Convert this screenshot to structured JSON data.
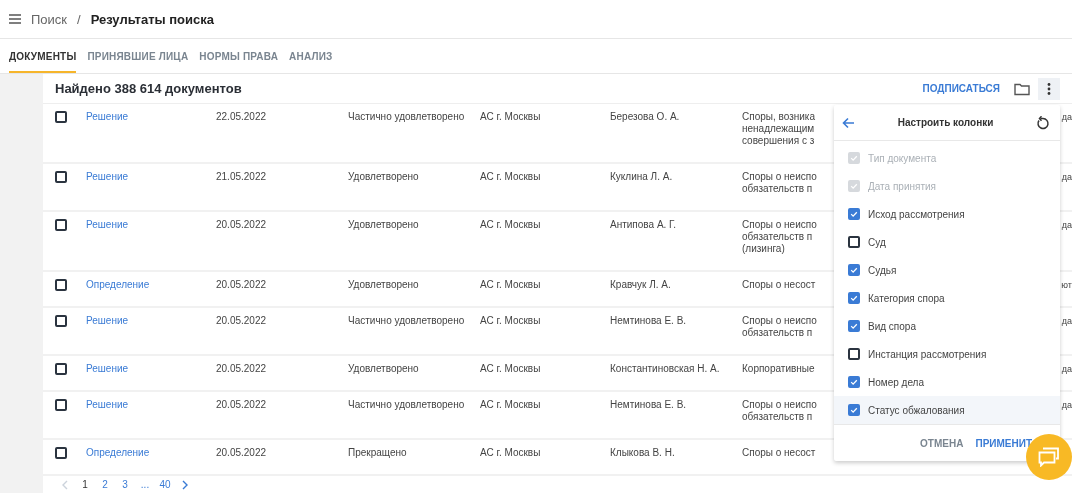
{
  "header": {
    "breadcrumb": [
      {
        "label": "Поиск",
        "current": false
      },
      {
        "label": "Результаты поиска",
        "current": true
      }
    ],
    "separator": "/"
  },
  "tabs": [
    {
      "label": "ДОКУМЕНТЫ",
      "selected": true
    },
    {
      "label": "ПРИНЯВШИЕ ЛИЦА",
      "selected": false
    },
    {
      "label": "НОРМЫ ПРАВА",
      "selected": false
    },
    {
      "label": "АНАЛИЗ",
      "selected": false
    }
  ],
  "results": {
    "title": "Найдено 388 614 документов",
    "subscribe": "ПОДПИСАТЬСЯ",
    "rows": [
      {
        "checked": false,
        "type": "Решение",
        "date": "22.05.2022",
        "outcome": "Частично удовлетворено",
        "court": "АС г. Москвы",
        "judge": "Березова О. А.",
        "category": [
          "Споры, возника",
          "ненадлежащим",
          "совершения с з"
        ],
        "column_7": "да"
      },
      {
        "checked": false,
        "type": "Решение",
        "date": "21.05.2022",
        "outcome": "Удовлетворено",
        "court": "АС г. Москвы",
        "judge": "Куклина Л. А.",
        "category": [
          "Споры о неиспо",
          "обязательств п"
        ],
        "column_7": "да"
      },
      {
        "checked": false,
        "type": "Решение",
        "date": "20.05.2022",
        "outcome": "Удовлетворено",
        "court": "АС г. Москвы",
        "judge": "Антипова А. Г.",
        "category": [
          "Споры о неиспо",
          "обязательств п",
          "(лизинга)"
        ],
        "column_7": "да"
      },
      {
        "checked": false,
        "type": "Определение",
        "date": "20.05.2022",
        "outcome": "Удовлетворено",
        "court": "АС г. Москвы",
        "judge": "Кравчук Л. А.",
        "category": [
          "Споры о несост"
        ],
        "column_7": "ют"
      },
      {
        "checked": false,
        "type": "Решение",
        "date": "20.05.2022",
        "outcome": "Частично удовлетворено",
        "court": "АС г. Москвы",
        "judge": "Немтинова Е. В.",
        "category": [
          "Споры о неиспо",
          "обязательств п"
        ],
        "column_7": "да"
      },
      {
        "checked": false,
        "type": "Решение",
        "date": "20.05.2022",
        "outcome": "Удовлетворено",
        "court": "АС г. Москвы",
        "judge": "Константиновская Н. А.",
        "category": [
          "Корпоративные"
        ],
        "column_7": "да"
      },
      {
        "checked": false,
        "type": "Решение",
        "date": "20.05.2022",
        "outcome": "Частично удовлетворено",
        "court": "АС г. Москвы",
        "judge": "Немтинова Е. В.",
        "category": [
          "Споры о неиспо",
          "обязательств п"
        ],
        "column_7": "да"
      },
      {
        "checked": false,
        "type": "Определение",
        "date": "20.05.2022",
        "outcome": "Прекращено",
        "court": "АС г. Москвы",
        "judge": "Клыкова В. Н.",
        "category": [
          "Споры о несост"
        ]
      }
    ]
  },
  "pagination": {
    "prev_disabled": true,
    "pages": [
      {
        "label": "1",
        "selected": true
      },
      {
        "label": "2",
        "selected": false
      },
      {
        "label": "3",
        "selected": false
      },
      {
        "label": "...",
        "selected": false
      },
      {
        "label": "40",
        "selected": false
      }
    ]
  },
  "columns_popup": {
    "title": "Настроить колонки",
    "items": [
      {
        "label": "Тип документа",
        "checked": true,
        "disabled": true,
        "highlighted": false
      },
      {
        "label": "Дата принятия",
        "checked": true,
        "disabled": true,
        "highlighted": false
      },
      {
        "label": "Исход рассмотрения",
        "checked": true,
        "disabled": false,
        "highlighted": false
      },
      {
        "label": "Суд",
        "checked": false,
        "disabled": false,
        "highlighted": false
      },
      {
        "label": "Судья",
        "checked": true,
        "disabled": false,
        "highlighted": false
      },
      {
        "label": "Категория спора",
        "checked": true,
        "disabled": false,
        "highlighted": false
      },
      {
        "label": "Вид спора",
        "checked": true,
        "disabled": false,
        "highlighted": false
      },
      {
        "label": "Инстанция рассмотрения",
        "checked": false,
        "disabled": false,
        "highlighted": false
      },
      {
        "label": "Номер дела",
        "checked": true,
        "disabled": false,
        "highlighted": false
      },
      {
        "label": "Статус обжалования",
        "checked": true,
        "disabled": false,
        "highlighted": true
      }
    ],
    "cancel": "ОТМЕНА",
    "apply": "ПРИМЕНИТ"
  }
}
